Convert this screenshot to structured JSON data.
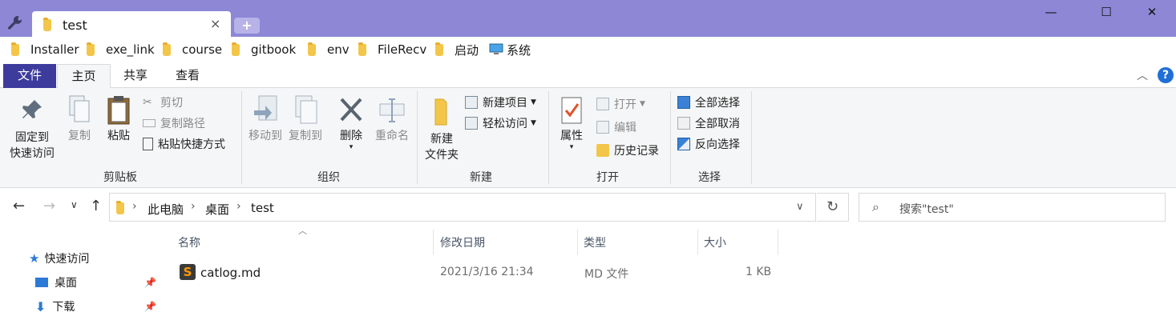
{
  "window": {
    "tab_title": "test",
    "tab_close": "×",
    "new_tab": "+",
    "minimize": "—",
    "maximize": "☐",
    "close": "✕",
    "title_bar_color": "#8d87d6"
  },
  "bookmarks": [
    "Installer",
    "exe_link",
    "course",
    "gitbook",
    "env",
    "FileRecv",
    "启动",
    "系统"
  ],
  "ribbon_tabs": [
    "文件",
    "主页",
    "共享",
    "查看"
  ],
  "ribbon": {
    "clipboard": {
      "pin_label_1": "固定到",
      "pin_label_2": "快速访问",
      "copy": "复制",
      "paste": "粘贴",
      "cut": "剪切",
      "copy_path": "复制路径",
      "paste_shortcut": "粘贴快捷方式",
      "group": "剪贴板"
    },
    "organize": {
      "move_to": "移动到",
      "copy_to": "复制到",
      "delete": "删除",
      "rename": "重命名",
      "group": "组织"
    },
    "new": {
      "new_folder_1": "新建",
      "new_folder_2": "文件夹",
      "new_item": "新建项目",
      "easy_access": "轻松访问",
      "group": "新建"
    },
    "open": {
      "properties": "属性",
      "open": "打开",
      "edit": "编辑",
      "history": "历史记录",
      "group": "打开"
    },
    "select": {
      "select_all": "全部选择",
      "select_none": "全部取消",
      "invert": "反向选择",
      "group": "选择"
    }
  },
  "address": {
    "crumbs": [
      "此电脑",
      "桌面",
      "test"
    ],
    "search_placeholder": "搜索\"test\""
  },
  "nav_pane": {
    "quick_access": "快速访问",
    "desktop": "桌面",
    "downloads": "下载"
  },
  "columns": [
    "名称",
    "修改日期",
    "类型",
    "大小"
  ],
  "files": [
    {
      "name": "catlog.md",
      "modified": "2021/3/16 21:34",
      "type": "MD 文件",
      "size": "1 KB"
    }
  ]
}
